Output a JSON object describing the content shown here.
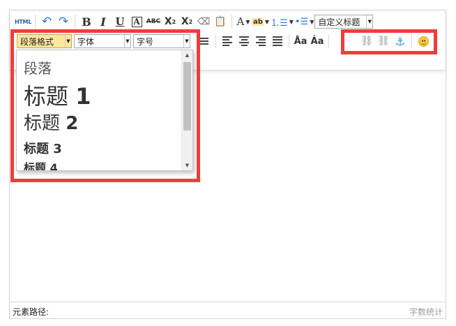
{
  "toolbar": {
    "html_label": "HTML",
    "bold": "B",
    "italic": "I",
    "underline": "U",
    "border": "A",
    "strike": "ABC",
    "sup": "X",
    "sup_mark": "2",
    "sub": "X",
    "sub_mark": "2",
    "font_color": "A",
    "backcolor": "ab",
    "custom_style": "自定义标题"
  },
  "row2": {
    "paragraph_format": "段落格式",
    "font_family": "字体",
    "font_size": "字号"
  },
  "dropdown": {
    "items": [
      {
        "text": "段落",
        "num": ""
      },
      {
        "text": "标题",
        "num": "1"
      },
      {
        "text": "标题",
        "num": "2"
      },
      {
        "text": "标题",
        "num": "3"
      },
      {
        "text": "标题",
        "num": "4"
      }
    ]
  },
  "statusbar": {
    "path_label": "元素路径:",
    "word_count": "字数统计"
  },
  "colors": {
    "highlight": "#f03c3c",
    "selected_select": "#ffe69f",
    "icon_blue": "#2d7ad6"
  }
}
